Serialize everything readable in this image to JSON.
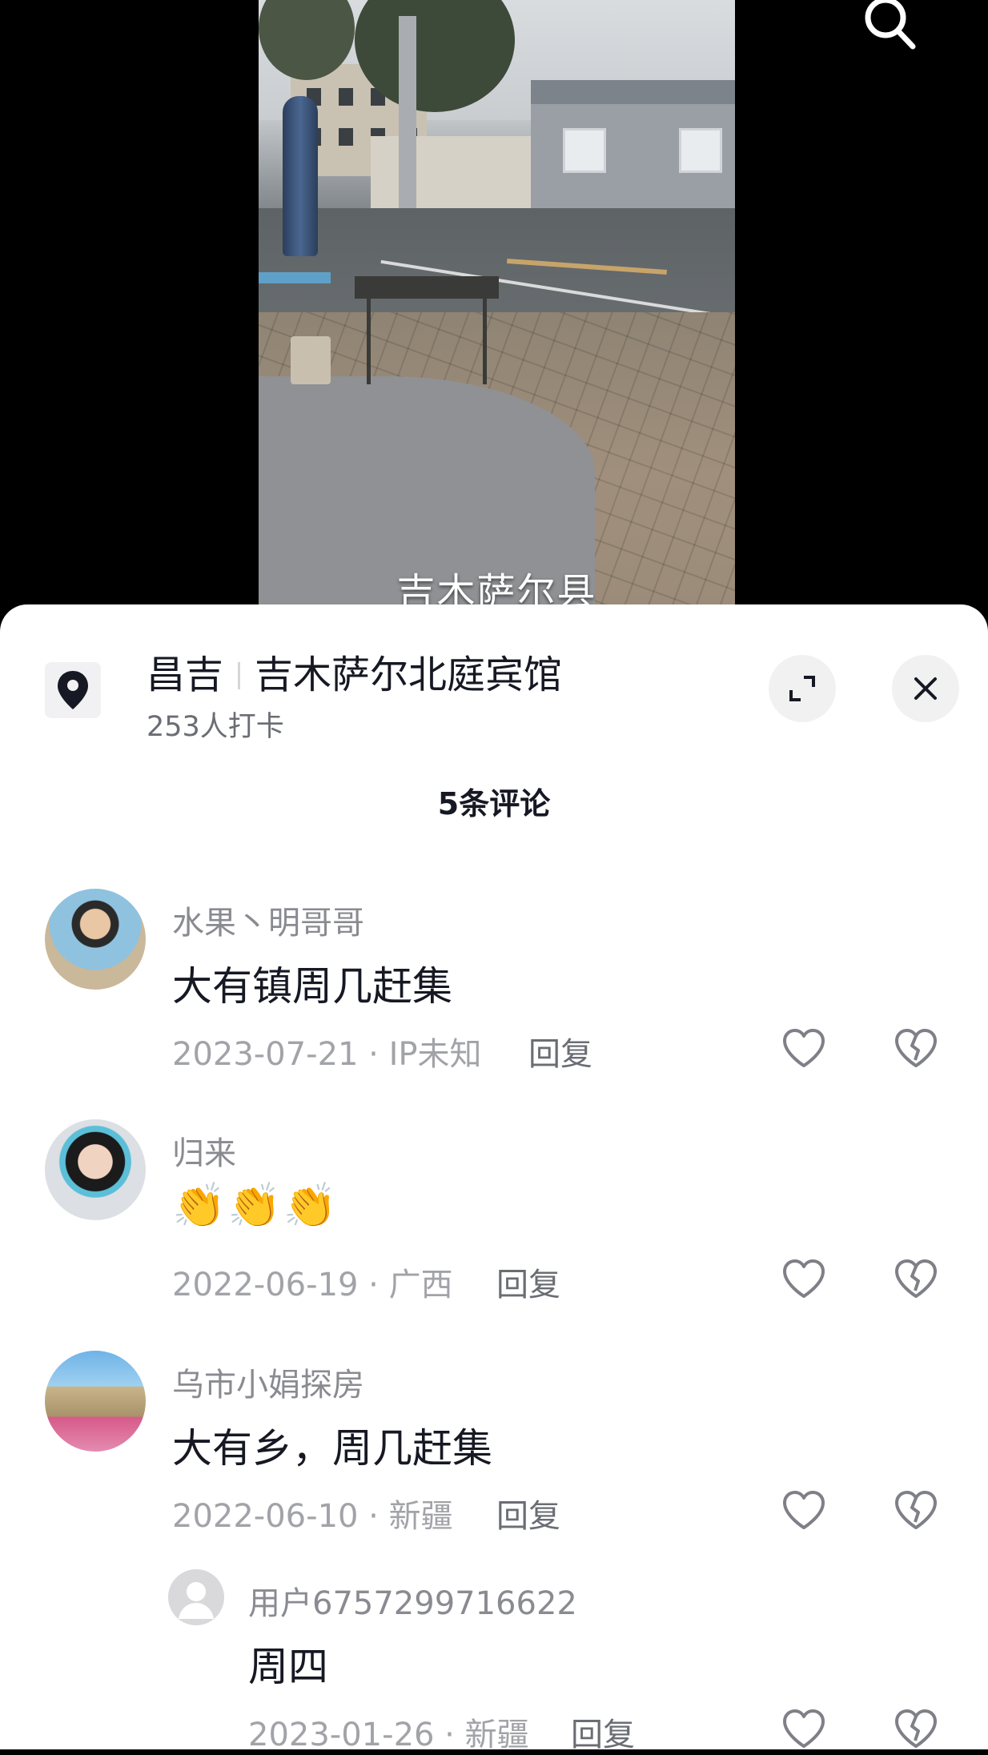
{
  "video": {
    "caption": "吉木萨尔县",
    "search_icon": "search-icon"
  },
  "poi": {
    "city": "昌吉",
    "name": "吉木萨尔北庭宾馆",
    "checkins": "253人打卡",
    "location_icon": "location-pin-icon",
    "expand_icon": "expand-icon",
    "close_icon": "close-icon"
  },
  "comments_header": "5条评论",
  "comments": [
    {
      "username": "水果丶明哥哥",
      "text": "大有镇周几赶集",
      "date": "2023-07-21",
      "location": "IP未知",
      "reply_label": "回复"
    },
    {
      "username": "归来",
      "text": "👏👏👏",
      "date": "2022-06-19",
      "location": "广西",
      "reply_label": "回复"
    },
    {
      "username": "乌市小娟探房",
      "text": "大有乡，周几赶集",
      "date": "2022-06-10",
      "location": "新疆",
      "reply_label": "回复"
    }
  ],
  "reply": {
    "username": "用户6757299716622",
    "text": "周四",
    "date": "2023-01-26",
    "location": "新疆",
    "reply_label": "回复"
  },
  "meta_separator": " · ",
  "colors": {
    "text_primary": "#161823",
    "text_secondary": "#8a8b91",
    "sheet_bg": "#ffffff"
  }
}
